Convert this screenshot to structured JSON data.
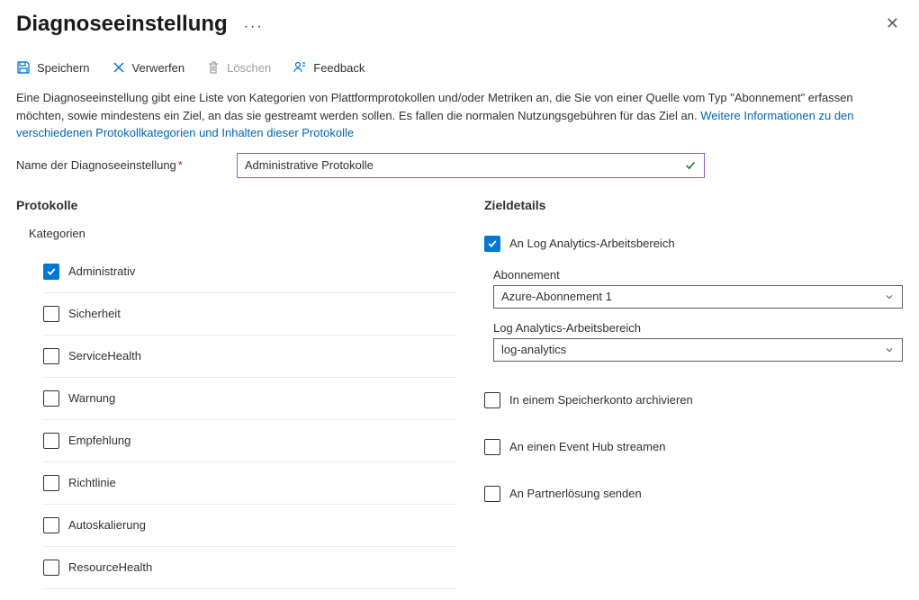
{
  "header": {
    "title": "Diagnoseeinstellung"
  },
  "toolbar": {
    "save": "Speichern",
    "discard": "Verwerfen",
    "delete": "Löschen",
    "feedback": "Feedback"
  },
  "description": {
    "text": "Eine Diagnoseeinstellung gibt eine Liste von Kategorien von Plattformprotokollen und/oder Metriken an, die Sie von einer Quelle vom Typ \"Abonnement\" erfassen möchten, sowie mindestens ein Ziel, an das sie gestreamt werden sollen. Es fallen die normalen Nutzungsgebühren für das Ziel an. ",
    "link": "Weitere Informationen zu den verschiedenen Protokollkategorien und Inhalten dieser Protokolle"
  },
  "name_field": {
    "label": "Name der Diagnoseeinstellung",
    "value": "Administrative Protokolle"
  },
  "protocols": {
    "title": "Protokolle",
    "subtitle": "Kategorien",
    "items": [
      {
        "label": "Administrativ",
        "checked": true
      },
      {
        "label": "Sicherheit",
        "checked": false
      },
      {
        "label": "ServiceHealth",
        "checked": false
      },
      {
        "label": "Warnung",
        "checked": false
      },
      {
        "label": "Empfehlung",
        "checked": false
      },
      {
        "label": "Richtlinie",
        "checked": false
      },
      {
        "label": "Autoskalierung",
        "checked": false
      },
      {
        "label": "ResourceHealth",
        "checked": false
      }
    ]
  },
  "destinations": {
    "title": "Zieldetails",
    "log_analytics": {
      "label": "An Log Analytics-Arbeitsbereich",
      "checked": true,
      "subscription_label": "Abonnement",
      "subscription_value": "Azure-Abonnement 1",
      "workspace_label": "Log Analytics-Arbeitsbereich",
      "workspace_value": "log-analytics"
    },
    "storage": {
      "label": "In einem Speicherkonto archivieren",
      "checked": false
    },
    "eventhub": {
      "label": "An einen Event Hub streamen",
      "checked": false
    },
    "partner": {
      "label": "An Partnerlösung senden",
      "checked": false
    }
  }
}
